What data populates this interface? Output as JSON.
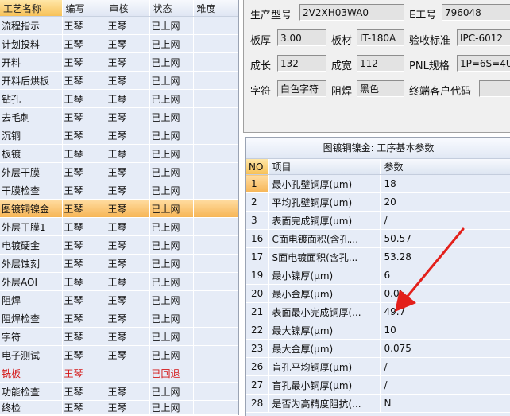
{
  "process_list": {
    "columns": [
      "工艺名称",
      "编写",
      "审核",
      "状态",
      "难度"
    ],
    "rows": [
      {
        "name": "流程指示",
        "writer": "王琴",
        "reviewer": "王琴",
        "status": "已上网",
        "difficulty": ""
      },
      {
        "name": "计划投料",
        "writer": "王琴",
        "reviewer": "王琴",
        "status": "已上网",
        "difficulty": ""
      },
      {
        "name": "开料",
        "writer": "王琴",
        "reviewer": "王琴",
        "status": "已上网",
        "difficulty": ""
      },
      {
        "name": "开料后烘板",
        "writer": "王琴",
        "reviewer": "王琴",
        "status": "已上网",
        "difficulty": ""
      },
      {
        "name": "钻孔",
        "writer": "王琴",
        "reviewer": "王琴",
        "status": "已上网",
        "difficulty": ""
      },
      {
        "name": "去毛刺",
        "writer": "王琴",
        "reviewer": "王琴",
        "status": "已上网",
        "difficulty": ""
      },
      {
        "name": "沉铜",
        "writer": "王琴",
        "reviewer": "王琴",
        "status": "已上网",
        "difficulty": ""
      },
      {
        "name": "板镀",
        "writer": "王琴",
        "reviewer": "王琴",
        "status": "已上网",
        "difficulty": ""
      },
      {
        "name": "外层干膜",
        "writer": "王琴",
        "reviewer": "王琴",
        "status": "已上网",
        "difficulty": ""
      },
      {
        "name": "干膜检查",
        "writer": "王琴",
        "reviewer": "王琴",
        "status": "已上网",
        "difficulty": ""
      },
      {
        "name": "图镀铜镍金",
        "writer": "王琴",
        "reviewer": "王琴",
        "status": "已上网",
        "difficulty": ""
      },
      {
        "name": "外层干膜1",
        "writer": "王琴",
        "reviewer": "王琴",
        "status": "已上网",
        "difficulty": ""
      },
      {
        "name": "电镀硬金",
        "writer": "王琴",
        "reviewer": "王琴",
        "status": "已上网",
        "difficulty": ""
      },
      {
        "name": "外层蚀刻",
        "writer": "王琴",
        "reviewer": "王琴",
        "status": "已上网",
        "difficulty": ""
      },
      {
        "name": "外层AOI",
        "writer": "王琴",
        "reviewer": "王琴",
        "status": "已上网",
        "difficulty": ""
      },
      {
        "name": "阻焊",
        "writer": "王琴",
        "reviewer": "王琴",
        "status": "已上网",
        "difficulty": ""
      },
      {
        "name": "阻焊检查",
        "writer": "王琴",
        "reviewer": "王琴",
        "status": "已上网",
        "difficulty": ""
      },
      {
        "name": "字符",
        "writer": "王琴",
        "reviewer": "王琴",
        "status": "已上网",
        "difficulty": ""
      },
      {
        "name": "电子测试",
        "writer": "王琴",
        "reviewer": "王琴",
        "status": "已上网",
        "difficulty": ""
      },
      {
        "name": "铣板",
        "writer": "王琴",
        "reviewer": "",
        "status": "已回退",
        "difficulty": ""
      },
      {
        "name": "功能检查",
        "writer": "王琴",
        "reviewer": "王琴",
        "status": "已上网",
        "difficulty": ""
      },
      {
        "name": "终检",
        "writer": "王琴",
        "reviewer": "王琴",
        "status": "已上网",
        "difficulty": ""
      }
    ],
    "selected_index": 10,
    "rejected_index": 19
  },
  "spec": {
    "model_label": "生产型号",
    "model_value": "2V2XH03WA0",
    "eno_label": "E工号",
    "eno_value": "796048",
    "thickness_label": "板厚",
    "thickness_value": "3.00",
    "material_label": "板材",
    "material_value": "IT-180A",
    "standard_label": "验收标准",
    "standard_value": "IPC-6012",
    "length_label": "成长",
    "length_value": "132",
    "width_label": "成宽",
    "width_value": "112",
    "pnl_label": "PNL规格",
    "pnl_value": "1P=6S=4U",
    "char_label": "字符",
    "char_value": "白色字符",
    "mask_label": "阻焊",
    "mask_value": "黑色",
    "customer_label": "终端客户代码",
    "customer_value": ""
  },
  "params": {
    "title": "图镀铜镍金: 工序基本参数",
    "columns": [
      "NO",
      "项目",
      "参数"
    ],
    "rows": [
      {
        "no": "1",
        "item": "最小孔壁铜厚(μm)",
        "value": "18"
      },
      {
        "no": "2",
        "item": "平均孔壁铜厚(um)",
        "value": "20"
      },
      {
        "no": "3",
        "item": "表面完成铜厚(um)",
        "value": "/"
      },
      {
        "no": "16",
        "item": "C面电镀面积(含孔...",
        "value": "50.57"
      },
      {
        "no": "17",
        "item": "S面电镀面积(含孔...",
        "value": "53.28"
      },
      {
        "no": "19",
        "item": "最小镍厚(μm)",
        "value": "6"
      },
      {
        "no": "20",
        "item": "最小金厚(μm)",
        "value": "0.05"
      },
      {
        "no": "21",
        "item": "表面最小完成铜厚(...",
        "value": "49.7"
      },
      {
        "no": "22",
        "item": "最大镍厚(μm)",
        "value": "10"
      },
      {
        "no": "23",
        "item": "最大金厚(μm)",
        "value": "0.075"
      },
      {
        "no": "26",
        "item": "盲孔平均铜厚(μm)",
        "value": "/"
      },
      {
        "no": "27",
        "item": "盲孔最小铜厚(μm)",
        "value": "/"
      },
      {
        "no": "28",
        "item": "是否为高精度阻抗(...",
        "value": "N"
      }
    ],
    "selected_index": 0
  },
  "colors": {
    "grid_bg": "#e6ecf7",
    "selection": "#f6b454",
    "rejected_text": "#d41616",
    "arrow": "#e3201b"
  }
}
